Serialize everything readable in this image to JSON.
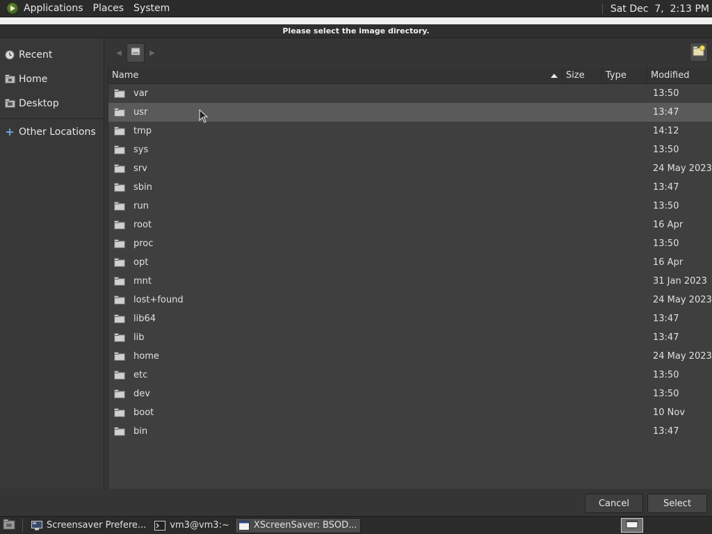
{
  "top_panel": {
    "menus": [
      "Applications",
      "Places",
      "System"
    ],
    "clock": "Sat Dec  7,  2:13 PM"
  },
  "dialog": {
    "title": "Please select the image directory.",
    "sidebar": {
      "items": [
        {
          "label": "Recent",
          "icon": "clock-icon"
        },
        {
          "label": "Home",
          "icon": "home-icon"
        },
        {
          "label": "Desktop",
          "icon": "desktop-icon"
        },
        {
          "label": "Other Locations",
          "icon": "plus-icon"
        }
      ]
    },
    "columns": {
      "name": "Name",
      "size": "Size",
      "type": "Type",
      "modified": "Modified"
    },
    "files": [
      {
        "name": "var",
        "modified": "13:50"
      },
      {
        "name": "usr",
        "modified": "13:47",
        "selected": true
      },
      {
        "name": "tmp",
        "modified": "14:12"
      },
      {
        "name": "sys",
        "modified": "13:50"
      },
      {
        "name": "srv",
        "modified": "24 May 2023"
      },
      {
        "name": "sbin",
        "modified": "13:47"
      },
      {
        "name": "run",
        "modified": "13:50"
      },
      {
        "name": "root",
        "modified": "16 Apr"
      },
      {
        "name": "proc",
        "modified": "13:50"
      },
      {
        "name": "opt",
        "modified": "16 Apr"
      },
      {
        "name": "mnt",
        "modified": "31 Jan 2023"
      },
      {
        "name": "lost+found",
        "modified": "24 May 2023"
      },
      {
        "name": "lib64",
        "modified": "13:47"
      },
      {
        "name": "lib",
        "modified": "13:47"
      },
      {
        "name": "home",
        "modified": "24 May 2023"
      },
      {
        "name": "etc",
        "modified": "13:50"
      },
      {
        "name": "dev",
        "modified": "13:50"
      },
      {
        "name": "boot",
        "modified": "10 Nov"
      },
      {
        "name": "bin",
        "modified": "13:47"
      }
    ],
    "buttons": {
      "cancel": "Cancel",
      "select": "Select"
    }
  },
  "taskbar": {
    "tasks": [
      {
        "label": "Screensaver Prefere...",
        "icon": "screensaver-icon",
        "active": false
      },
      {
        "label": "vm3@vm3:~",
        "icon": "terminal-icon",
        "active": false
      },
      {
        "label": "XScreenSaver: BSOD...",
        "icon": "window-icon",
        "active": true
      }
    ]
  },
  "colors": {
    "panel": "#2b2b2b",
    "dialog": "#353535",
    "list": "#3f3f3f",
    "selected_row": "#5a5a5a",
    "text": "#e0e0e0"
  }
}
